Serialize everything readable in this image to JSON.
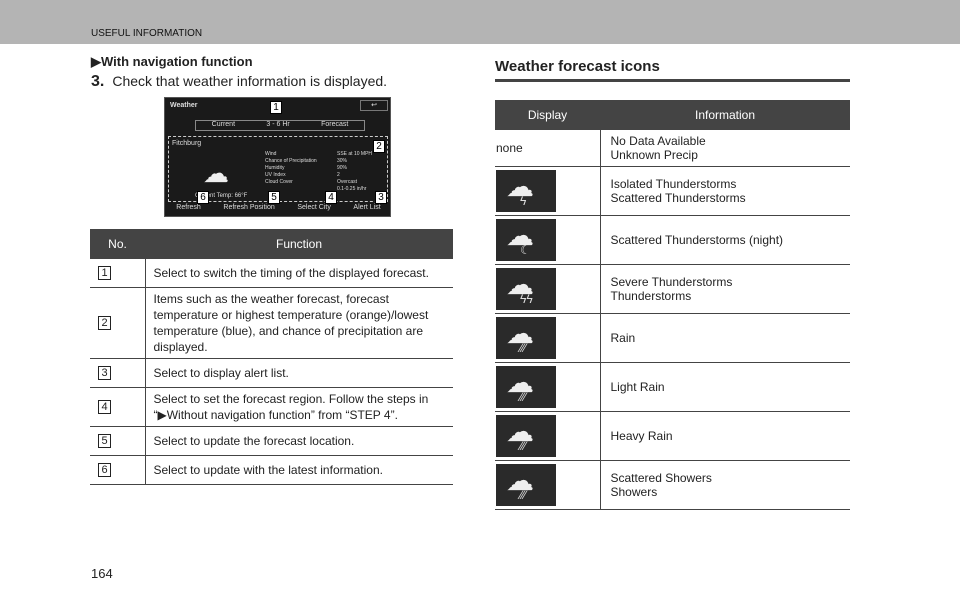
{
  "header": {
    "title": "USEFUL INFORMATION"
  },
  "left": {
    "subheading": "▶With navigation function",
    "step_num": "3.",
    "step_text": "Check that weather information is displayed.",
    "screen": {
      "title": "Weather",
      "tabs": [
        "Current",
        "3 - 6 Hr",
        "Forecast"
      ],
      "city": "Fitchburg",
      "labels": [
        "Wind",
        "Chance of Precipitation",
        "Humidity",
        "UV Index",
        "Cloud Cover"
      ],
      "values": [
        "SSE at 10 MPH",
        "30%",
        "90%",
        "2",
        "Overcast"
      ],
      "temp": "Current Temp: 66°F",
      "rate": "0.1-0.25 in/hr",
      "buttons": [
        "Refresh",
        "Refresh Position",
        "Select City",
        "Alert List"
      ],
      "badges": [
        "1",
        "2",
        "3",
        "4",
        "5",
        "6"
      ]
    },
    "table": {
      "headers": [
        "No.",
        "Function"
      ],
      "rows": [
        {
          "no": "1",
          "text": "Select to switch the timing of the displayed forecast."
        },
        {
          "no": "2",
          "text": "Items such as the weather forecast, forecast temperature or highest temperature (orange)/lowest temperature (blue), and chance of precipitation are displayed."
        },
        {
          "no": "3",
          "text": "Select to display alert list."
        },
        {
          "no": "4",
          "text": "Select to set the forecast region. Follow the steps in “▶Without navigation function” from “STEP 4”."
        },
        {
          "no": "5",
          "text": "Select to update the forecast location."
        },
        {
          "no": "6",
          "text": "Select to update with the latest information."
        }
      ]
    }
  },
  "right": {
    "title": "Weather forecast icons",
    "table": {
      "headers": [
        "Display",
        "Information"
      ],
      "rows": [
        {
          "display": "none",
          "icon": "",
          "info": [
            "No Data Available",
            "Unknown Precip"
          ]
        },
        {
          "icon": "thunderstorm-icon",
          "info": [
            "Isolated Thunderstorms",
            "Scattered Thunderstorms"
          ]
        },
        {
          "icon": "thunderstorm-night-icon",
          "info": [
            "Scattered Thunderstorms (night)"
          ]
        },
        {
          "icon": "severe-thunderstorm-icon",
          "info": [
            "Severe Thunderstorms",
            "Thunderstorms"
          ]
        },
        {
          "icon": "rain-icon",
          "info": [
            "Rain"
          ]
        },
        {
          "icon": "light-rain-icon",
          "info": [
            "Light Rain"
          ]
        },
        {
          "icon": "heavy-rain-icon",
          "info": [
            "Heavy Rain"
          ]
        },
        {
          "icon": "showers-icon",
          "info": [
            "Scattered Showers",
            "Showers"
          ]
        }
      ]
    }
  },
  "page_number": "164"
}
